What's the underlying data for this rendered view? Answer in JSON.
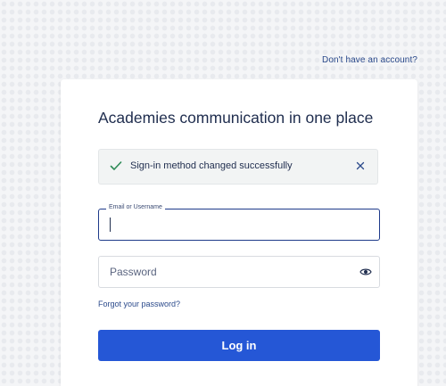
{
  "header": {
    "signup_link": "Don't have an account?"
  },
  "card": {
    "title": "Academies communication in one place",
    "alert": {
      "message": "Sign-in method changed successfully",
      "icon": "check-icon",
      "close_icon": "close-icon",
      "color": "#2e8b57"
    },
    "username_field": {
      "label": "Email or Username",
      "value": ""
    },
    "password_field": {
      "placeholder": "Password",
      "toggle_icon": "eye-icon"
    },
    "forgot_link": "Forgot your password?",
    "login_button": "Log in",
    "login_button_color": "#2557d6"
  }
}
